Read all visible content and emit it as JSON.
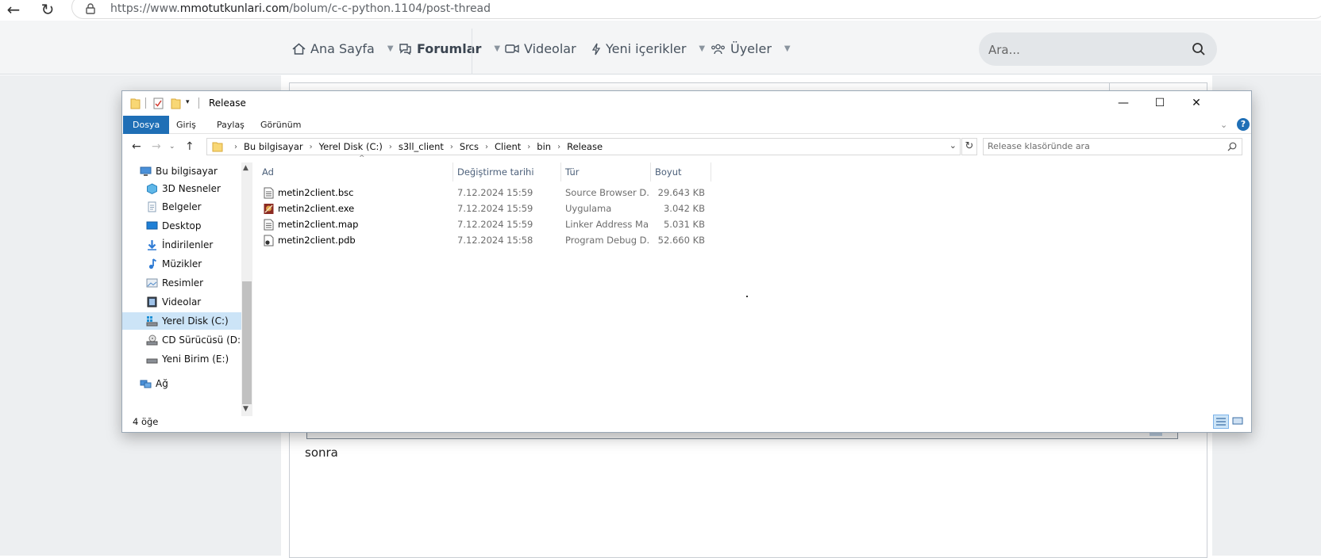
{
  "browser": {
    "url_prefix": "https://www.",
    "url_domain": "mmotutkunlari.com",
    "url_path": "/bolum/c-c-python.1104/post-thread",
    "back_icon": "back-arrow-icon",
    "reload_icon": "reload-icon"
  },
  "forum_nav": {
    "items": [
      {
        "label": "Ana Sayfa",
        "icon": "home-icon"
      },
      {
        "label": "Forumlar",
        "icon": "comments-icon"
      },
      {
        "label": "Videolar",
        "icon": "video-icon"
      },
      {
        "label": "Yeni içerikler",
        "icon": "bolt-icon"
      },
      {
        "label": "Üyeler",
        "icon": "users-icon"
      }
    ],
    "search_placeholder": "Ara..."
  },
  "editor": {
    "body_text": "sonra",
    "pasted_status_fragment": "4 öğe"
  },
  "explorer": {
    "title": "Release",
    "ribbon_tabs": [
      "Dosya",
      "Giriş",
      "Paylaş",
      "Görünüm"
    ],
    "help": "?",
    "breadcrumb": [
      "Bu bilgisayar",
      "Yerel Disk (C:)",
      "s3ll_client",
      "Srcs",
      "Client",
      "bin",
      "Release"
    ],
    "search_placeholder": "Release klasöründe ara",
    "tree": [
      {
        "label": "Bu bilgisayar",
        "icon": "computer-icon"
      },
      {
        "label": "3D Nesneler",
        "icon": "3d-objects-icon"
      },
      {
        "label": "Belgeler",
        "icon": "documents-icon"
      },
      {
        "label": "Desktop",
        "icon": "desktop-icon"
      },
      {
        "label": "İndirilenler",
        "icon": "downloads-icon"
      },
      {
        "label": "Müzikler",
        "icon": "music-icon"
      },
      {
        "label": "Resimler",
        "icon": "pictures-icon"
      },
      {
        "label": "Videolar",
        "icon": "videos-icon"
      },
      {
        "label": "Yerel Disk (C:)",
        "icon": "drive-icon"
      },
      {
        "label": "CD Sürücüsü (D:)",
        "icon": "cd-drive-icon"
      },
      {
        "label": "Yeni Birim (E:)",
        "icon": "drive-icon"
      },
      {
        "label": "Ağ",
        "icon": "network-icon"
      }
    ],
    "selected_tree": "Yerel Disk (C:)",
    "columns": [
      "Ad",
      "Değiştirme tarihi",
      "Tür",
      "Boyut"
    ],
    "files": [
      {
        "name": "metin2client.bsc",
        "date": "7.12.2024 15:59",
        "type": "Source Browser D...",
        "size": "29.643 KB",
        "icon": "file-icon"
      },
      {
        "name": "metin2client.exe",
        "date": "7.12.2024 15:59",
        "type": "Uygulama",
        "size": "3.042 KB",
        "icon": "app-icon"
      },
      {
        "name": "metin2client.map",
        "date": "7.12.2024 15:59",
        "type": "Linker Address Map",
        "size": "5.031 KB",
        "icon": "file-icon"
      },
      {
        "name": "metin2client.pdb",
        "date": "7.12.2024 15:58",
        "type": "Program Debug D...",
        "size": "52.660 KB",
        "icon": "debug-file-icon"
      }
    ],
    "status": "4 öğe"
  },
  "colors": {
    "ribbon_file_tab": "#1f6fb6",
    "selection": "#cce4f7",
    "page_bg": "#edeff1"
  }
}
